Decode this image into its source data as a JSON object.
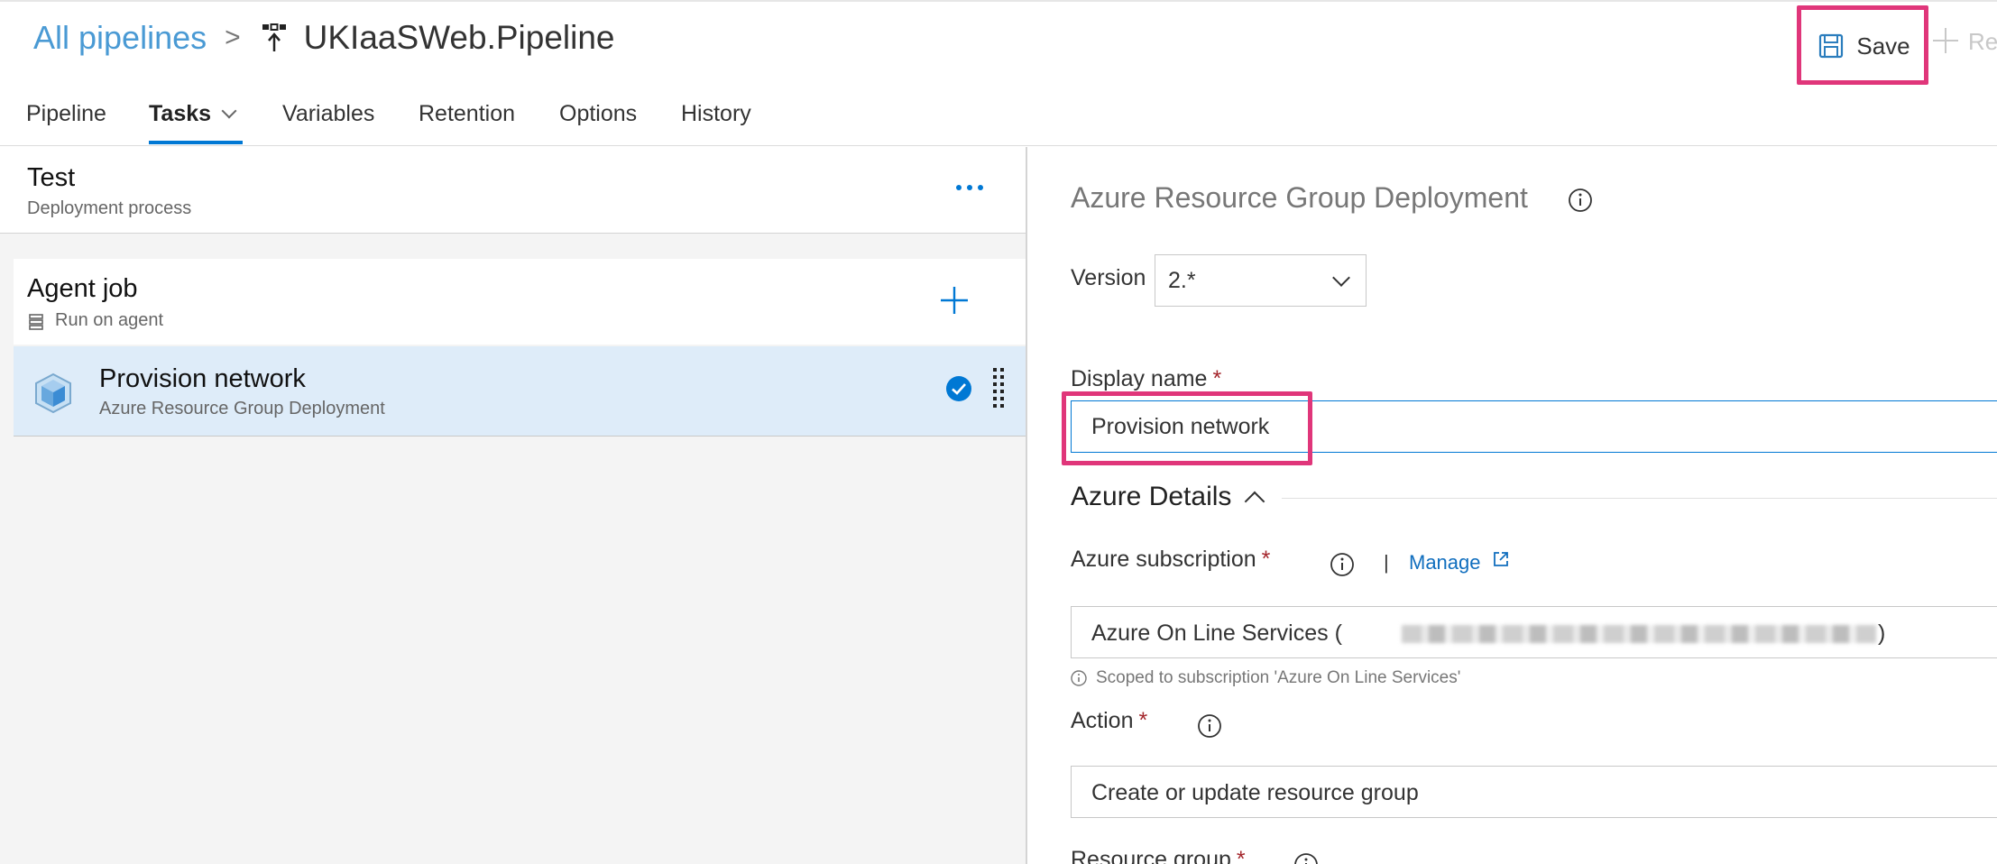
{
  "header": {
    "breadcrumb_root": "All pipelines",
    "breadcrumb_separator": ">",
    "title": "UKIaaSWeb.Pipeline",
    "save_label": "Save",
    "release_label": "Re"
  },
  "tabs": [
    {
      "label": "Pipeline",
      "active": false
    },
    {
      "label": "Tasks",
      "active": true
    },
    {
      "label": "Variables",
      "active": false
    },
    {
      "label": "Retention",
      "active": false
    },
    {
      "label": "Options",
      "active": false
    },
    {
      "label": "History",
      "active": false
    }
  ],
  "stage": {
    "name": "Test",
    "subtitle": "Deployment process"
  },
  "agent_job": {
    "name": "Agent job",
    "subtitle": "Run on agent"
  },
  "task": {
    "name": "Provision network",
    "type": "Azure Resource Group Deployment",
    "enabled": true
  },
  "task_detail": {
    "title": "Azure Resource Group Deployment",
    "version_label": "Version",
    "version_value": "2.*",
    "display_name_label": "Display name",
    "display_name_value": "Provision network",
    "required_marker": "*",
    "section_azure_details": "Azure Details",
    "subscription_label": "Azure subscription",
    "manage_label": "Manage",
    "pipe": "|",
    "subscription_value": "Azure On Line Services (",
    "subscription_value_close": ")",
    "subscription_hint": "Scoped to subscription 'Azure On Line Services'",
    "action_label": "Action",
    "action_value": "Create or update resource group",
    "resource_group_label": "Resource group"
  },
  "colors": {
    "accent": "#0078d4",
    "link": "#4a9ad4",
    "highlight": "#e0367a",
    "selected_row": "#deecf9",
    "required": "#a4262c"
  }
}
